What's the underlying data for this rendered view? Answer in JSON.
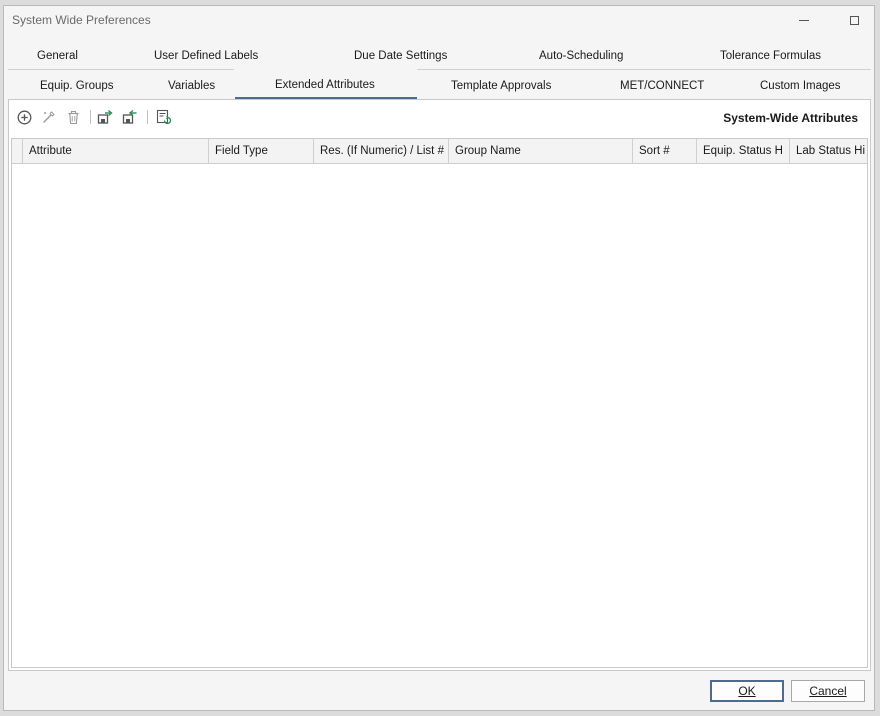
{
  "window": {
    "title": "System Wide Preferences"
  },
  "tabs": {
    "row1": [
      {
        "label": "General"
      },
      {
        "label": "User Defined Labels"
      },
      {
        "label": "Due Date Settings"
      },
      {
        "label": "Auto-Scheduling"
      },
      {
        "label": "Tolerance Formulas"
      }
    ],
    "row2": [
      {
        "label": "Equip. Groups"
      },
      {
        "label": "Variables"
      },
      {
        "label": "Extended Attributes",
        "active": true
      },
      {
        "label": "Template Approvals"
      },
      {
        "label": "MET/CONNECT"
      },
      {
        "label": "Custom Images"
      }
    ]
  },
  "toolbar": {
    "icons": [
      "add-icon",
      "edit-icon",
      "delete-icon",
      "export-icon",
      "import-icon",
      "refresh-list-icon"
    ],
    "section_title": "System-Wide Attributes"
  },
  "grid": {
    "columns": [
      {
        "label": "Attribute"
      },
      {
        "label": "Field Type"
      },
      {
        "label": "Res. (If Numeric) / List #"
      },
      {
        "label": "Group Name"
      },
      {
        "label": "Sort #"
      },
      {
        "label": "Equip. Status H"
      },
      {
        "label": "Lab Status Hi"
      }
    ],
    "rows": []
  },
  "buttons": {
    "ok_label": "OK",
    "cancel_label": "Cancel"
  },
  "colors": {
    "accent": "#4e6a8f",
    "icon_gray": "#555555",
    "icon_disabled": "#9a9a9a",
    "icon_green": "#2e8b57"
  }
}
